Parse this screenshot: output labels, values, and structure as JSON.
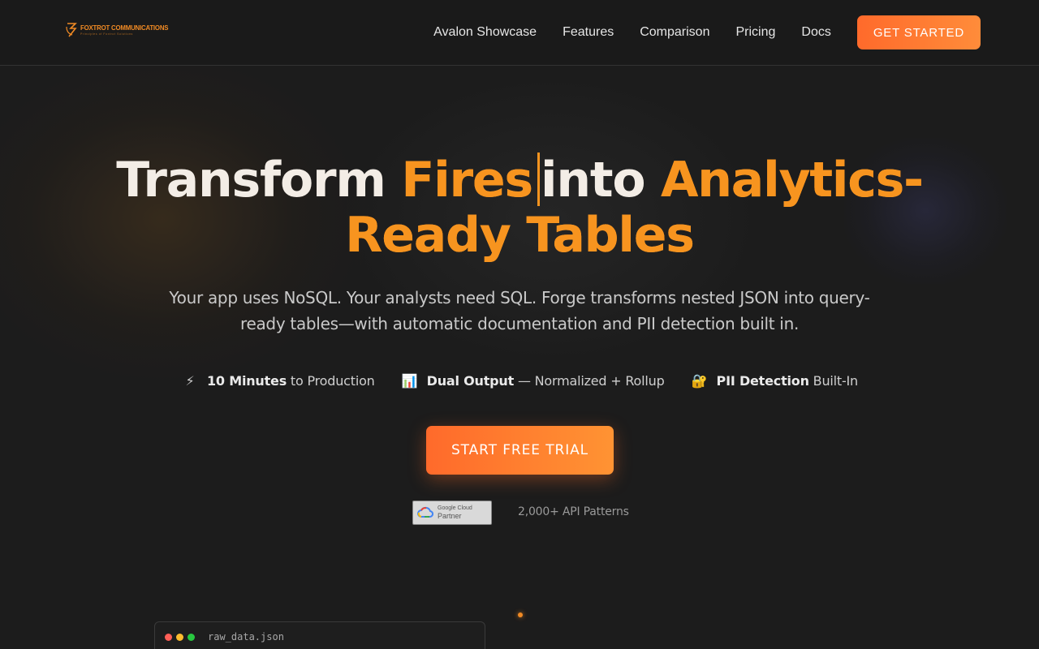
{
  "brand": {
    "name": "FOXTROT COMMUNICATIONS",
    "tagline": "Principles of Foxtrot Solutions",
    "logo_icon": "foxtrot-logo-icon"
  },
  "nav": {
    "links": [
      "Avalon Showcase",
      "Features",
      "Comparison",
      "Pricing",
      "Docs"
    ],
    "cta_label": "GET STARTED"
  },
  "hero": {
    "title_part1": "Transform",
    "title_accent1": "Fires",
    "title_part2": "into",
    "title_accent2": "Analytics-",
    "title_accent3": "Ready Tables",
    "subtitle_line1": "Your app uses NoSQL. Your analysts need SQL. Forge transforms nested JSON into query-",
    "subtitle_line2": "ready tables—with automatic documentation and PII detection built in."
  },
  "features": [
    {
      "icon": "lightning-icon",
      "glyph": "⚡",
      "bold": "10 Minutes",
      "rest": " to Production"
    },
    {
      "icon": "bar-chart-icon",
      "glyph": "📊",
      "bold": "Dual Output",
      "rest": " — Normalized + Rollup"
    },
    {
      "icon": "lock-key-icon",
      "glyph": "🔐",
      "bold": "PII Detection",
      "rest": " Built-In"
    }
  ],
  "cta": {
    "trial_label": "START FREE TRIAL"
  },
  "trust": {
    "badge_top": "Google Cloud",
    "badge_bottom": "Partner",
    "badge_icon": "google-cloud-icon",
    "api_patterns": "2,000+ API Patterns"
  },
  "code_window": {
    "filename": "raw_data.json",
    "dot_colors": [
      "#ff5f57",
      "#febc2e",
      "#28c840"
    ]
  },
  "colors": {
    "accent": "#f7941f",
    "cta_gradient_start": "#ff6a2b",
    "cta_gradient_end": "#ff9333",
    "background": "#1c1c1c"
  }
}
